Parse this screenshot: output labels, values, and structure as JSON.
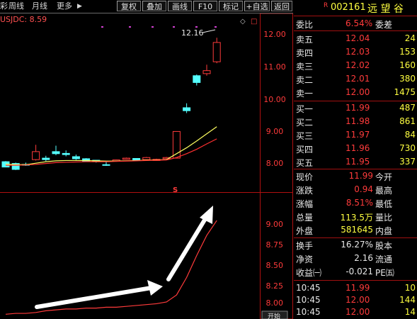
{
  "toolbar": {
    "left_partial": "彩",
    "period_week": "周线",
    "period_month": "月线",
    "more": "更多",
    "more_arrow": "▶",
    "btn_recover": "复权",
    "btn_overlay": "叠加",
    "btn_draw": "画线",
    "btn_f10": "F10",
    "btn_mark": "标记",
    "btn_watch": "+自选",
    "btn_back": "返回"
  },
  "chart": {
    "indicator_label": "USJDC: 8.59",
    "high_annotation": "12.16",
    "main_axis_ticks": [
      "12.00",
      "11.00",
      "10.00",
      "9.00",
      "8.00"
    ],
    "sub_axis_ticks": [
      "9.00",
      "8.75",
      "8.50",
      "8.25",
      "8.00"
    ],
    "signal_marker": "S",
    "bottom_button": "开始",
    "colors": {
      "up": "#ff3b3b",
      "down": "#54ffff",
      "ma_short": "#ffff60",
      "ma_long": "#ff3030"
    }
  },
  "chart_data": {
    "type": "candlestick",
    "ylim": [
      7.6,
      12.5
    ],
    "candles": [
      {
        "open": 7.98,
        "close": 7.8,
        "high": 8.0,
        "low": 7.8
      },
      {
        "open": 7.92,
        "close": 7.72,
        "high": 7.95,
        "low": 7.7
      },
      {
        "open": 7.89,
        "close": 7.86,
        "high": 7.95,
        "low": 7.84
      },
      {
        "open": 8.05,
        "close": 8.32,
        "high": 8.55,
        "low": 8.02
      },
      {
        "open": 8.1,
        "close": 8.05,
        "high": 8.18,
        "low": 8.0
      },
      {
        "open": 8.32,
        "close": 8.25,
        "high": 8.52,
        "low": 8.2
      },
      {
        "open": 8.26,
        "close": 8.22,
        "high": 8.36,
        "low": 8.16
      },
      {
        "open": 8.15,
        "close": 8.08,
        "high": 8.22,
        "low": 8.04
      },
      {
        "open": 8.08,
        "close": 8.0,
        "high": 8.1,
        "low": 7.98
      },
      {
        "open": 8.03,
        "close": 7.98,
        "high": 8.03,
        "low": 7.95
      },
      {
        "open": 7.88,
        "close": 7.86,
        "high": 7.98,
        "low": 7.84
      },
      {
        "open": 8.0,
        "close": 8.04,
        "high": 8.05,
        "low": 7.98
      },
      {
        "open": 8.06,
        "close": 8.1,
        "high": 8.12,
        "low": 8.05
      },
      {
        "open": 8.09,
        "close": 8.03,
        "high": 8.1,
        "low": 8.02
      },
      {
        "open": 8.05,
        "close": 8.12,
        "high": 8.14,
        "low": 8.04
      },
      {
        "open": 8.02,
        "close": 8.06,
        "high": 8.08,
        "low": 8.01
      },
      {
        "open": 8.08,
        "close": 8.12,
        "high": 8.14,
        "low": 8.06
      },
      {
        "open": 8.1,
        "close": 9.0,
        "high": 9.0,
        "low": 8.1
      },
      {
        "open": 9.8,
        "close": 9.7,
        "high": 9.95,
        "low": 9.62
      },
      {
        "open": 10.88,
        "close": 10.65,
        "high": 10.92,
        "low": 10.55
      },
      {
        "open": 10.95,
        "close": 11.05,
        "high": 11.25,
        "low": 10.88
      },
      {
        "open": 11.35,
        "close": 12.0,
        "high": 12.16,
        "low": 11.3
      }
    ],
    "ma_short": [
      7.9,
      7.88,
      7.88,
      7.93,
      7.98,
      8.01,
      8.02,
      8.02,
      8.02,
      8.01,
      8.0,
      8.0,
      8.01,
      8.02,
      8.03,
      8.04,
      8.05,
      8.25,
      8.45,
      8.68,
      8.92,
      9.16
    ],
    "ma_long": [
      7.86,
      7.86,
      7.87,
      7.89,
      7.92,
      7.95,
      7.96,
      7.97,
      7.98,
      7.98,
      7.98,
      7.99,
      8.0,
      8.01,
      8.02,
      8.03,
      8.04,
      8.12,
      8.25,
      8.4,
      8.58,
      8.75
    ],
    "sub_ylim": [
      7.95,
      9.35
    ],
    "sub_line": [
      7.98,
      7.99,
      7.99,
      8.0,
      8.02,
      8.03,
      8.04,
      8.04,
      8.05,
      8.05,
      8.06,
      8.06,
      8.07,
      8.08,
      8.09,
      8.1,
      8.12,
      8.2,
      8.4,
      8.65,
      8.88,
      9.05
    ]
  },
  "panel": {
    "r_badge": "R",
    "code": "002161",
    "name": "远 望 谷",
    "weibi_label": "委比",
    "weibi_value": "6.54%",
    "weicha_label": "委差",
    "asks": [
      {
        "label": "卖五",
        "price": "12.04",
        "vol": "24"
      },
      {
        "label": "卖四",
        "price": "12.03",
        "vol": "153"
      },
      {
        "label": "卖三",
        "price": "12.02",
        "vol": "160"
      },
      {
        "label": "卖二",
        "price": "12.01",
        "vol": "380"
      },
      {
        "label": "卖一",
        "price": "12.00",
        "vol": "1475"
      }
    ],
    "bids": [
      {
        "label": "买一",
        "price": "11.99",
        "vol": "487"
      },
      {
        "label": "买二",
        "price": "11.98",
        "vol": "861"
      },
      {
        "label": "买三",
        "price": "11.97",
        "vol": "84"
      },
      {
        "label": "买四",
        "price": "11.96",
        "vol": "730"
      },
      {
        "label": "买五",
        "price": "11.95",
        "vol": "337"
      }
    ],
    "stats_left": [
      {
        "label": "现价",
        "value": "11.99"
      },
      {
        "label": "涨跌",
        "value": "0.94"
      },
      {
        "label": "涨幅",
        "value": "8.51%"
      },
      {
        "label": "总量",
        "value": "113.5万"
      },
      {
        "label": "外盘",
        "value": "581645"
      }
    ],
    "stats_right": [
      "今开",
      "最高",
      "最低",
      "量比",
      "内盘"
    ],
    "stats2_left": [
      {
        "label": "换手",
        "value": "16.27%"
      },
      {
        "label": "净资",
        "value": "2.16"
      },
      {
        "label": "收益㈠",
        "value": "-0.021"
      }
    ],
    "stats2_right": [
      "股本",
      "流通",
      "PE㈤"
    ],
    "ticks": [
      {
        "time": "10:45",
        "price": "11.99",
        "vol": "10"
      },
      {
        "time": "10:45",
        "price": "12.00",
        "vol": "144"
      },
      {
        "time": "10:45",
        "price": "12.00",
        "vol": "14"
      }
    ]
  }
}
